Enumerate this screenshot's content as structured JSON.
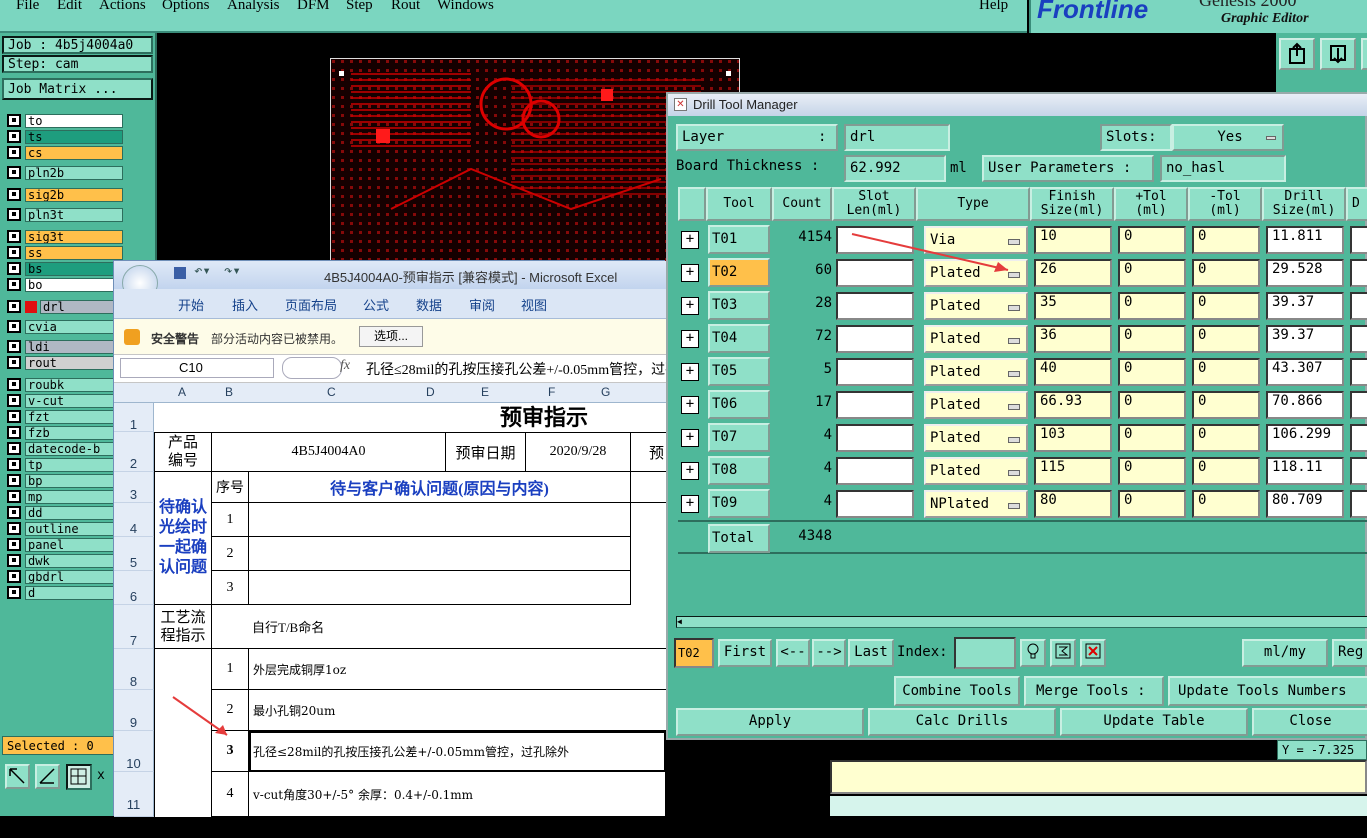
{
  "menubar": {
    "items": [
      "File",
      "Edit",
      "Actions",
      "Options",
      "Analysis",
      "DFM",
      "Step",
      "Rout",
      "Windows"
    ],
    "help": "Help"
  },
  "logo": {
    "brand": "Frontline",
    "product": "Genesis 2000",
    "subtitle": "Graphic Editor"
  },
  "job": {
    "job_label": "Job : 4b5j4004a0",
    "step_label": "Step: cam",
    "matrix_button": "Job Matrix ...",
    "selected": "Selected : 0"
  },
  "layers": [
    {
      "name": "to",
      "color": "#ffffff"
    },
    {
      "name": "ts",
      "color": "#1e9d7e"
    },
    {
      "name": "cs",
      "color": "#ffc04a"
    },
    {
      "name": "pln2b",
      "color": "#8fe0c8"
    },
    {
      "name": "sig2b",
      "color": "#ffc04a"
    },
    {
      "name": "pln3t",
      "color": "#8fe0c8"
    },
    {
      "name": "sig3t",
      "color": "#ffc04a"
    },
    {
      "name": "ss",
      "color": "#ffc04a"
    },
    {
      "name": "bs",
      "color": "#1e9d7e"
    },
    {
      "name": "bo",
      "color": "#ffffff"
    },
    {
      "name": "drl",
      "color": "#b0b8c4"
    },
    {
      "name": "cvia",
      "color": "#8fe0c8"
    },
    {
      "name": "ldi",
      "color": "#b0b8c4"
    },
    {
      "name": "rout",
      "color": "#d0d0d0"
    },
    {
      "name": "roubk",
      "color": "#8fe0c8"
    },
    {
      "name": "v-cut",
      "color": "#8fe0c8"
    },
    {
      "name": "fzt",
      "color": "#8fe0c8"
    },
    {
      "name": "fzb",
      "color": "#8fe0c8"
    },
    {
      "name": "datecode-b",
      "color": "#8fe0c8"
    },
    {
      "name": "tp",
      "color": "#8fe0c8"
    },
    {
      "name": "bp",
      "color": "#8fe0c8"
    },
    {
      "name": "mp",
      "color": "#8fe0c8"
    },
    {
      "name": "dd",
      "color": "#8fe0c8"
    },
    {
      "name": "outline",
      "color": "#8fe0c8"
    },
    {
      "name": "panel",
      "color": "#8fe0c8"
    },
    {
      "name": "dwk",
      "color": "#8fe0c8"
    },
    {
      "name": "gbdrl",
      "color": "#8fe0c8"
    },
    {
      "name": "d",
      "color": "#8fe0c8"
    }
  ],
  "coord_readout": "Y = -7.325",
  "excel": {
    "title": "4B5J4004A0-预审指示 [兼容模式] - Microsoft Excel",
    "ribbon_tabs": [
      "开始",
      "插入",
      "页面布局",
      "公式",
      "数据",
      "审阅",
      "视图"
    ],
    "warning_label": "安全警告",
    "warning_text": "部分活动内容已被禁用。",
    "options_button": "选项...",
    "name_box": "C10",
    "fx": "fx",
    "formula": "孔径≤28mil的孔按压接孔公差+/-0.05mm管控，过孔除外",
    "col_headers": [
      "A",
      "B",
      "C",
      "D",
      "E",
      "F",
      "G"
    ],
    "row_headers": [
      "1",
      "2",
      "3",
      "4",
      "5",
      "6",
      "7",
      "8",
      "9",
      "10",
      "11"
    ],
    "sheet_title": "预审指示",
    "product_label": "产品编号",
    "product_value": "4B5J4004A0",
    "date_label": "预审日期",
    "date_value": "2020/9/28",
    "date_extra": "预",
    "seq_label": "序号",
    "issues_header": "待与客户确认问题(原因与内容)",
    "confirm_label": "待确认光绘时一起确认问题",
    "seq_numbers": [
      "1",
      "2",
      "3"
    ],
    "process_label": "工艺流程指示",
    "process_first": "自行T/B命名",
    "steps": [
      {
        "n": "1",
        "text": "外层完成铜厚1oz"
      },
      {
        "n": "2",
        "text": "最小孔铜20um"
      },
      {
        "n": "3",
        "text": "孔径≤28mil的孔按压接孔公差+/-0.05mm管控，过孔除外"
      },
      {
        "n": "4",
        "text": "v-cut角度30+/-5° 余厚：0.4+/-0.1mm"
      }
    ]
  },
  "dtm": {
    "title": "Drill Tool Manager",
    "layer_label": "Layer",
    "layer_colon": ":",
    "layer_value": "drl",
    "slots_label": "Slots:",
    "slots_value": "Yes",
    "thickness_label": "Board Thickness :",
    "thickness_value": "62.992",
    "thickness_unit": "ml",
    "user_params_label": "User Parameters :",
    "user_params_value": "no_hasl",
    "headers": {
      "tool": "Tool",
      "count": "Count",
      "slot": "Slot\nLen(ml)",
      "type": "Type",
      "finish": "Finish\nSize(ml)",
      "ptol": "+Tol\n(ml)",
      "mtol": "-Tol\n(ml)",
      "drill": "Drill\nSize(ml)",
      "extra": "D"
    },
    "tools": [
      {
        "tool": "T01",
        "count": "4154",
        "type": "Via",
        "finish": "10",
        "ptol": "0",
        "mtol": "0",
        "drill": "11.811"
      },
      {
        "tool": "T02",
        "count": "60",
        "type": "Plated",
        "finish": "26",
        "ptol": "0",
        "mtol": "0",
        "drill": "29.528"
      },
      {
        "tool": "T03",
        "count": "28",
        "type": "Plated",
        "finish": "35",
        "ptol": "0",
        "mtol": "0",
        "drill": "39.37"
      },
      {
        "tool": "T04",
        "count": "72",
        "type": "Plated",
        "finish": "36",
        "ptol": "0",
        "mtol": "0",
        "drill": "39.37"
      },
      {
        "tool": "T05",
        "count": "5",
        "type": "Plated",
        "finish": "40",
        "ptol": "0",
        "mtol": "0",
        "drill": "43.307"
      },
      {
        "tool": "T06",
        "count": "17",
        "type": "Plated",
        "finish": "66.93",
        "ptol": "0",
        "mtol": "0",
        "drill": "70.866"
      },
      {
        "tool": "T07",
        "count": "4",
        "type": "Plated",
        "finish": "103",
        "ptol": "0",
        "mtol": "0",
        "drill": "106.299"
      },
      {
        "tool": "T08",
        "count": "4",
        "type": "Plated",
        "finish": "115",
        "ptol": "0",
        "mtol": "0",
        "drill": "118.11"
      },
      {
        "tool": "T09",
        "count": "4",
        "type": "NPlated",
        "finish": "80",
        "ptol": "0",
        "mtol": "0",
        "drill": "80.709"
      }
    ],
    "total_label": "Total",
    "total_value": "4348",
    "current_tool": "T02",
    "nav": {
      "first": "First",
      "prev": "<--",
      "next": "-->",
      "last": "Last",
      "index": "Index:",
      "units": "ml/my",
      "reg": "Reg"
    },
    "tools_buttons": {
      "combine": "Combine Tools",
      "merge": "Merge Tools :",
      "update_numbers": "Update Tools Numbers"
    },
    "bottom_buttons": {
      "apply": "Apply",
      "calc": "Calc Drills",
      "update": "Update Table",
      "close": "Close"
    }
  }
}
